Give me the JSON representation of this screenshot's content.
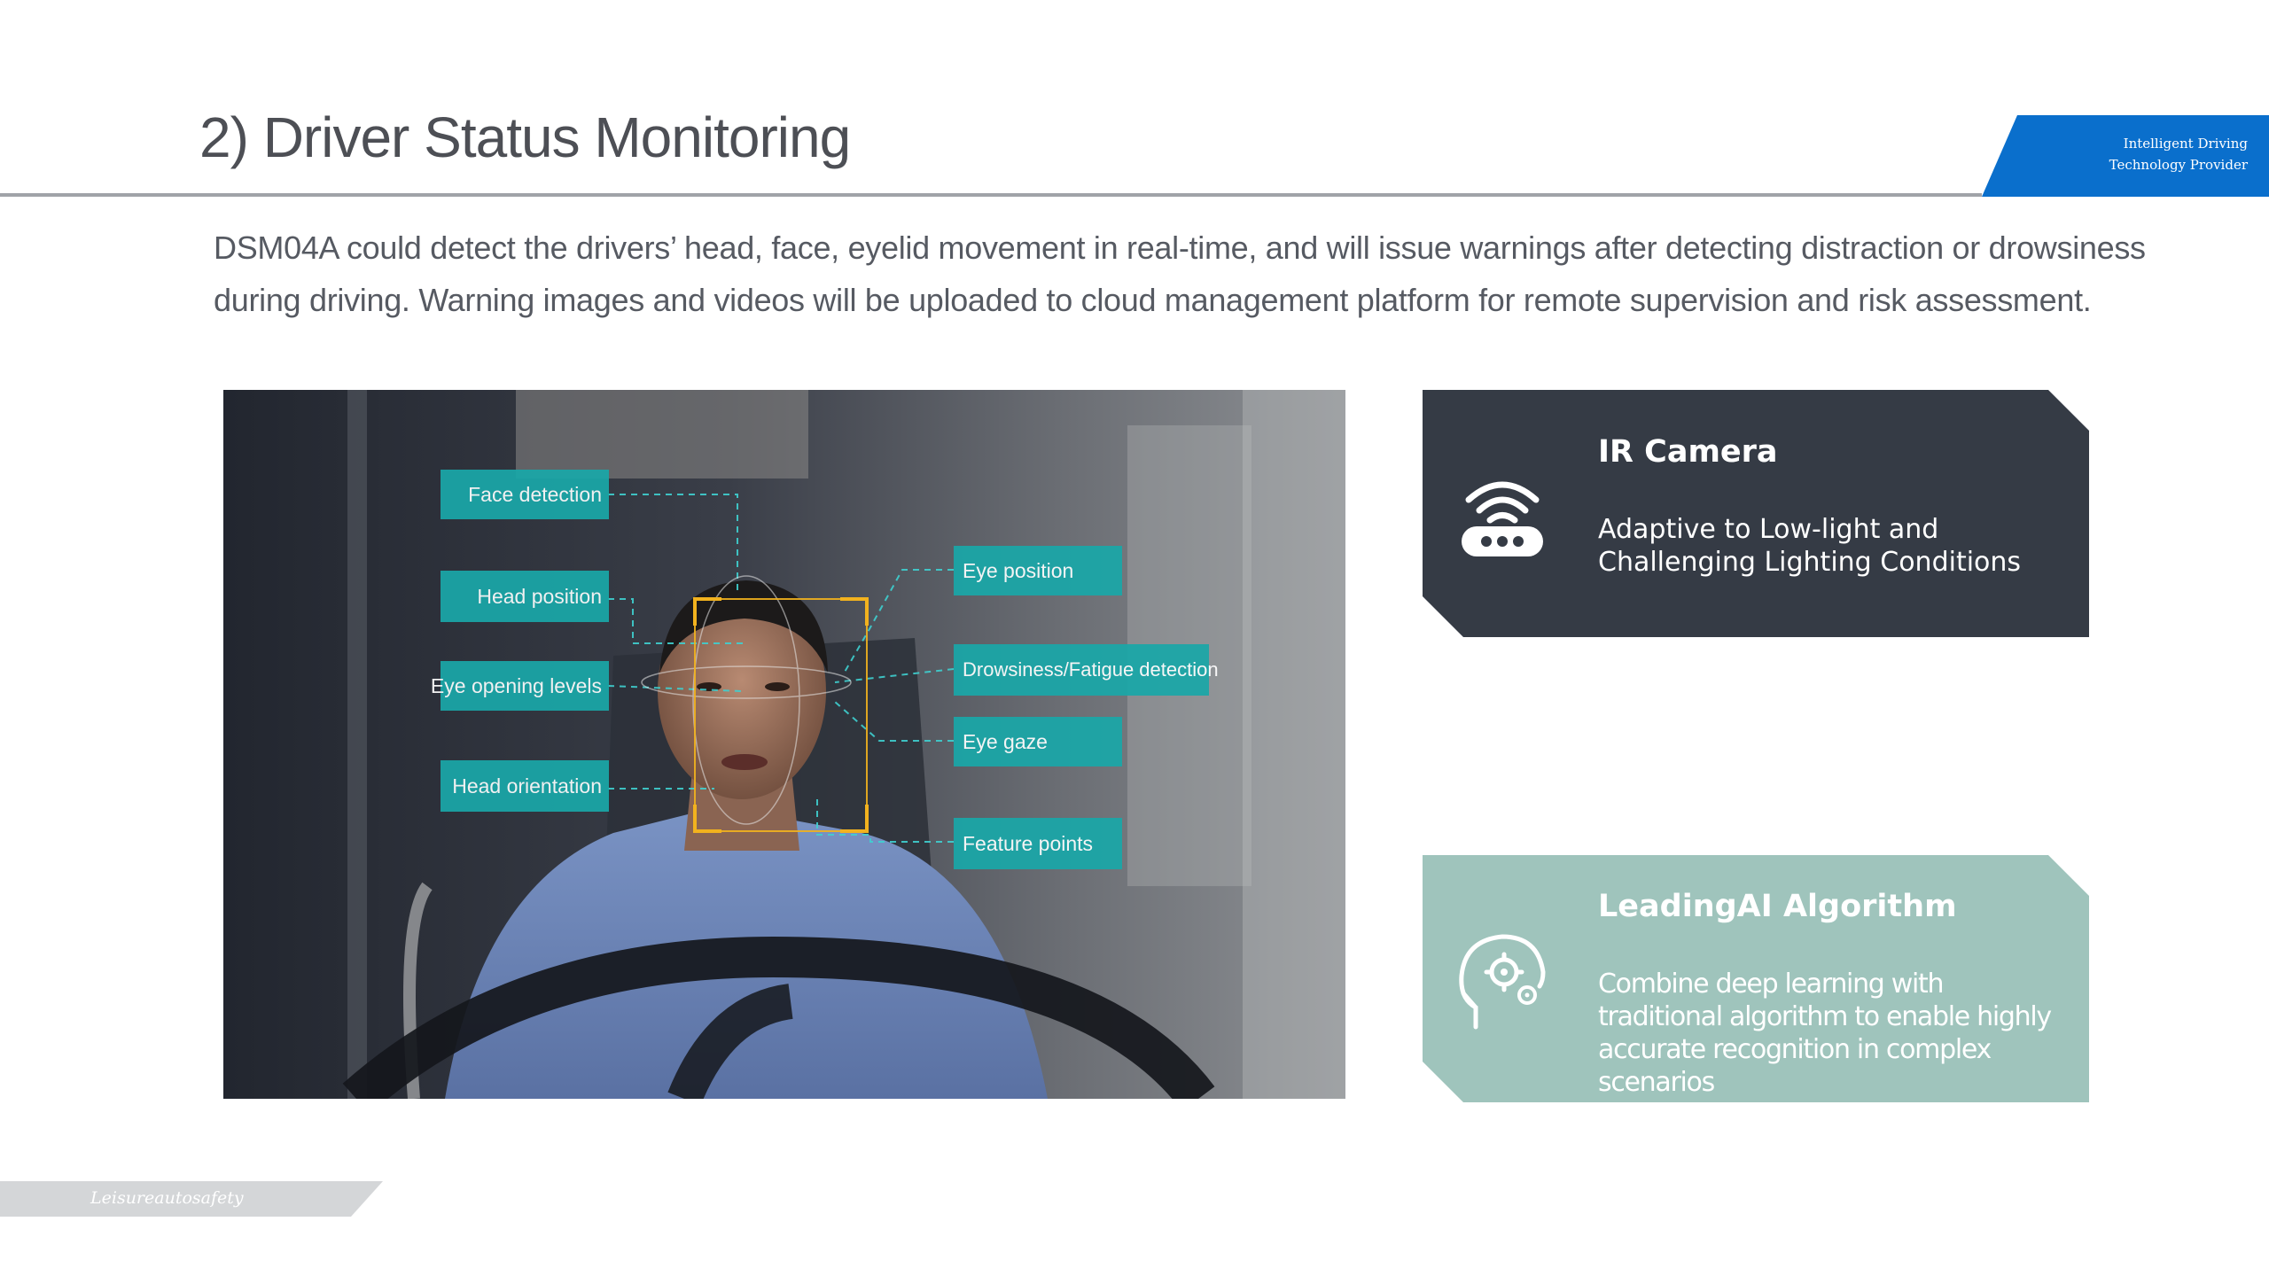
{
  "header": {
    "title": "2) Driver Status Monitoring",
    "brand_line1": "Intelligent Driving",
    "brand_line2": "Technology Provider",
    "accent_color": "#0a6fcc"
  },
  "intro": {
    "text": "DSM04A could detect the drivers’ head, face, eyelid movement in real-time, and will issue warnings after detecting distraction or drowsiness during driving. Warning images and videos will be uploaded to cloud management platform for remote supervision and risk assessment."
  },
  "photo": {
    "left_tags": [
      "Face detection",
      "Head position",
      "Eye opening levels",
      "Head orientation"
    ],
    "right_tags": [
      "Eye position",
      "Drowsiness/Fatigue detection",
      "Eye gaze",
      "Feature points"
    ],
    "tag_color": "#1aa7a8",
    "face_box_color": "#f2b21e"
  },
  "cards": [
    {
      "title": "IR Camera",
      "description": "Adaptive to Low-light and Challenging Lighting Conditions",
      "icon": "wifi-camera-icon",
      "color": "#353b45"
    },
    {
      "title": "LeadingAI Algorithm",
      "description": "Combine deep learning with traditional algorithm to enable highly accurate recognition in complex scenarios",
      "icon": "head-gears-icon",
      "color": "#9fc4bc"
    }
  ],
  "footer": {
    "brand": "Leisureautosafety"
  }
}
